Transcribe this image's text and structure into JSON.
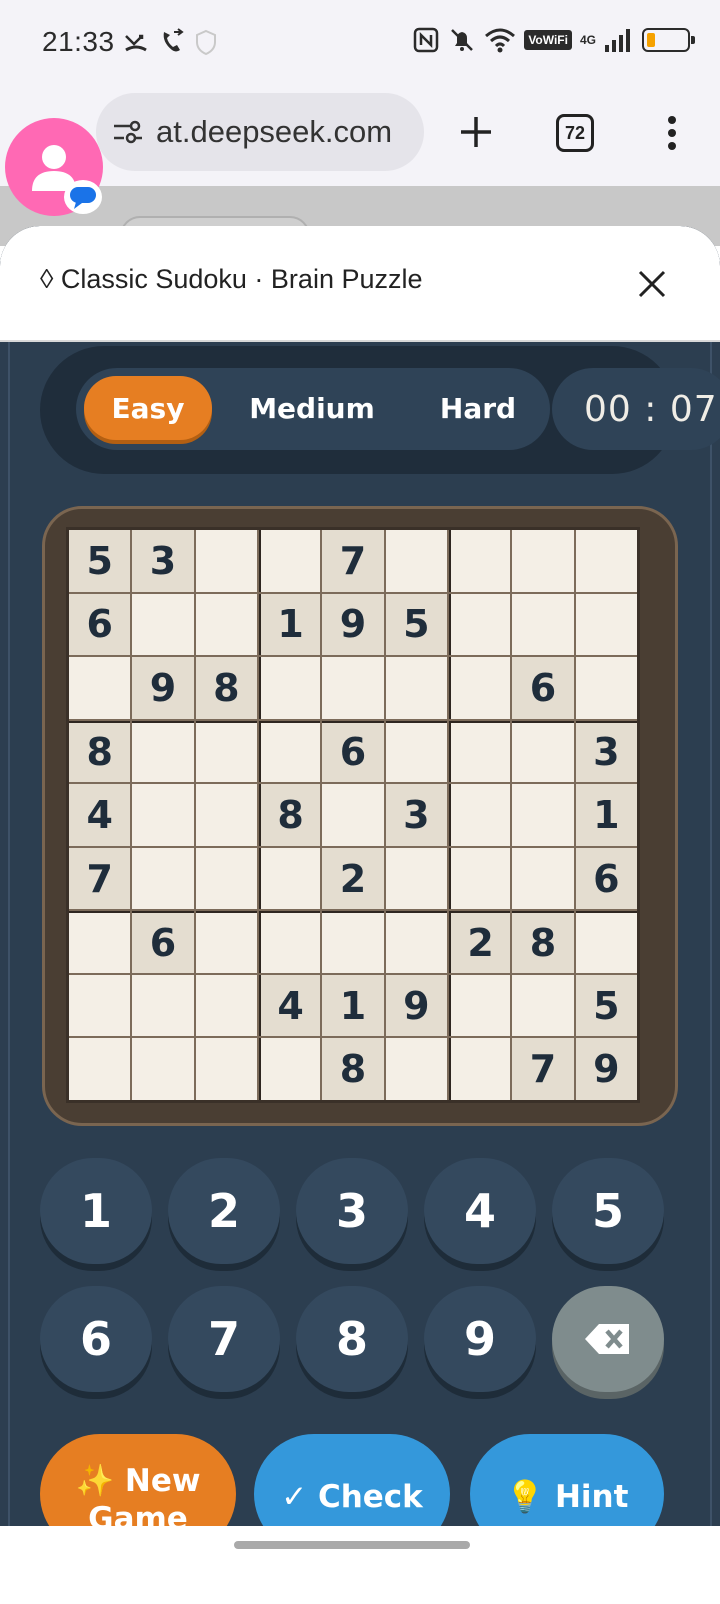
{
  "status_bar": {
    "time": "21:33",
    "wifi_label": "VoWiFi",
    "network": "4G",
    "battery_level": 0.2,
    "battery_color": "#f5a100"
  },
  "browser": {
    "url": "at.deepseek.com",
    "tab_count": "72",
    "icons": [
      "site-settings-icon",
      "plus-icon",
      "overflow-menu-icon",
      "avatar-icon",
      "chat-bubble-icon"
    ]
  },
  "sheet": {
    "title": "◊ Classic Sudoku · Brain Puzzle"
  },
  "game": {
    "difficulty": {
      "options": [
        "Easy",
        "Medium",
        "Hard"
      ],
      "selected": "Easy"
    },
    "timer": "00 : 07",
    "board": [
      [
        5,
        3,
        0,
        0,
        7,
        0,
        0,
        0,
        0
      ],
      [
        6,
        0,
        0,
        1,
        9,
        5,
        0,
        0,
        0
      ],
      [
        0,
        9,
        8,
        0,
        0,
        0,
        0,
        6,
        0
      ],
      [
        8,
        0,
        0,
        0,
        6,
        0,
        0,
        0,
        3
      ],
      [
        4,
        0,
        0,
        8,
        0,
        3,
        0,
        0,
        1
      ],
      [
        7,
        0,
        0,
        0,
        2,
        0,
        0,
        0,
        6
      ],
      [
        0,
        6,
        0,
        0,
        0,
        0,
        2,
        8,
        0
      ],
      [
        0,
        0,
        0,
        4,
        1,
        9,
        0,
        0,
        5
      ],
      [
        0,
        0,
        0,
        0,
        8,
        0,
        0,
        7,
        9
      ]
    ],
    "numpad": [
      "1",
      "2",
      "3",
      "4",
      "5",
      "6",
      "7",
      "8",
      "9"
    ],
    "erase_icon": "backspace-icon",
    "actions": {
      "new_game_line1": "✨ New",
      "new_game_line2": "Game",
      "check": "✓ Check",
      "hint": "💡 Hint"
    }
  },
  "colors": {
    "accent_orange": "#e67e22",
    "accent_blue": "#3498db",
    "app_bg": "#2c3e50",
    "given_cell": "#e4ddd0",
    "empty_cell": "#f4efe6"
  }
}
